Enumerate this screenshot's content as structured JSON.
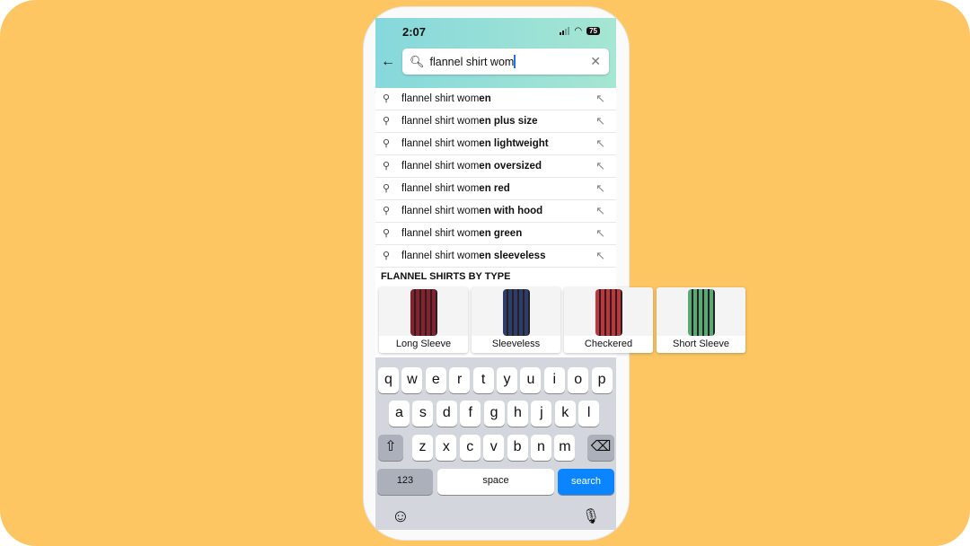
{
  "status": {
    "time": "2:07",
    "battery": "75"
  },
  "search": {
    "value": "flannel shirt wom"
  },
  "suggestions": [
    {
      "typed": "flannel shirt wom",
      "completion": "en"
    },
    {
      "typed": "flannel shirt wom",
      "completion": "en plus size"
    },
    {
      "typed": "flannel shirt wom",
      "completion": "en lightweight"
    },
    {
      "typed": "flannel shirt wom",
      "completion": "en oversized"
    },
    {
      "typed": "flannel shirt wom",
      "completion": "en red"
    },
    {
      "typed": "flannel shirt wom",
      "completion": "en with hood"
    },
    {
      "typed": "flannel shirt wom",
      "completion": "en green"
    },
    {
      "typed": "flannel shirt wom",
      "completion": "en sleeveless"
    }
  ],
  "section": {
    "title": "FLANNEL SHIRTS BY TYPE",
    "cards": [
      {
        "label": "Long Sleeve",
        "color": "#8a1f2e"
      },
      {
        "label": "Sleeveless",
        "color": "#2d3c6a"
      },
      {
        "label": "Checkered",
        "color": "#c0343a"
      },
      {
        "label": "Short Sleeve",
        "color": "#5aa873"
      }
    ]
  },
  "keyboard": {
    "row1": [
      "q",
      "w",
      "e",
      "r",
      "t",
      "y",
      "u",
      "i",
      "o",
      "p"
    ],
    "row2": [
      "a",
      "s",
      "d",
      "f",
      "g",
      "h",
      "j",
      "k",
      "l"
    ],
    "row3": [
      "z",
      "x",
      "c",
      "v",
      "b",
      "n",
      "m"
    ],
    "numbers": "123",
    "space": "space",
    "search": "search"
  },
  "colors": {
    "background": "#fdc663",
    "search_key": "#0a84ff"
  }
}
